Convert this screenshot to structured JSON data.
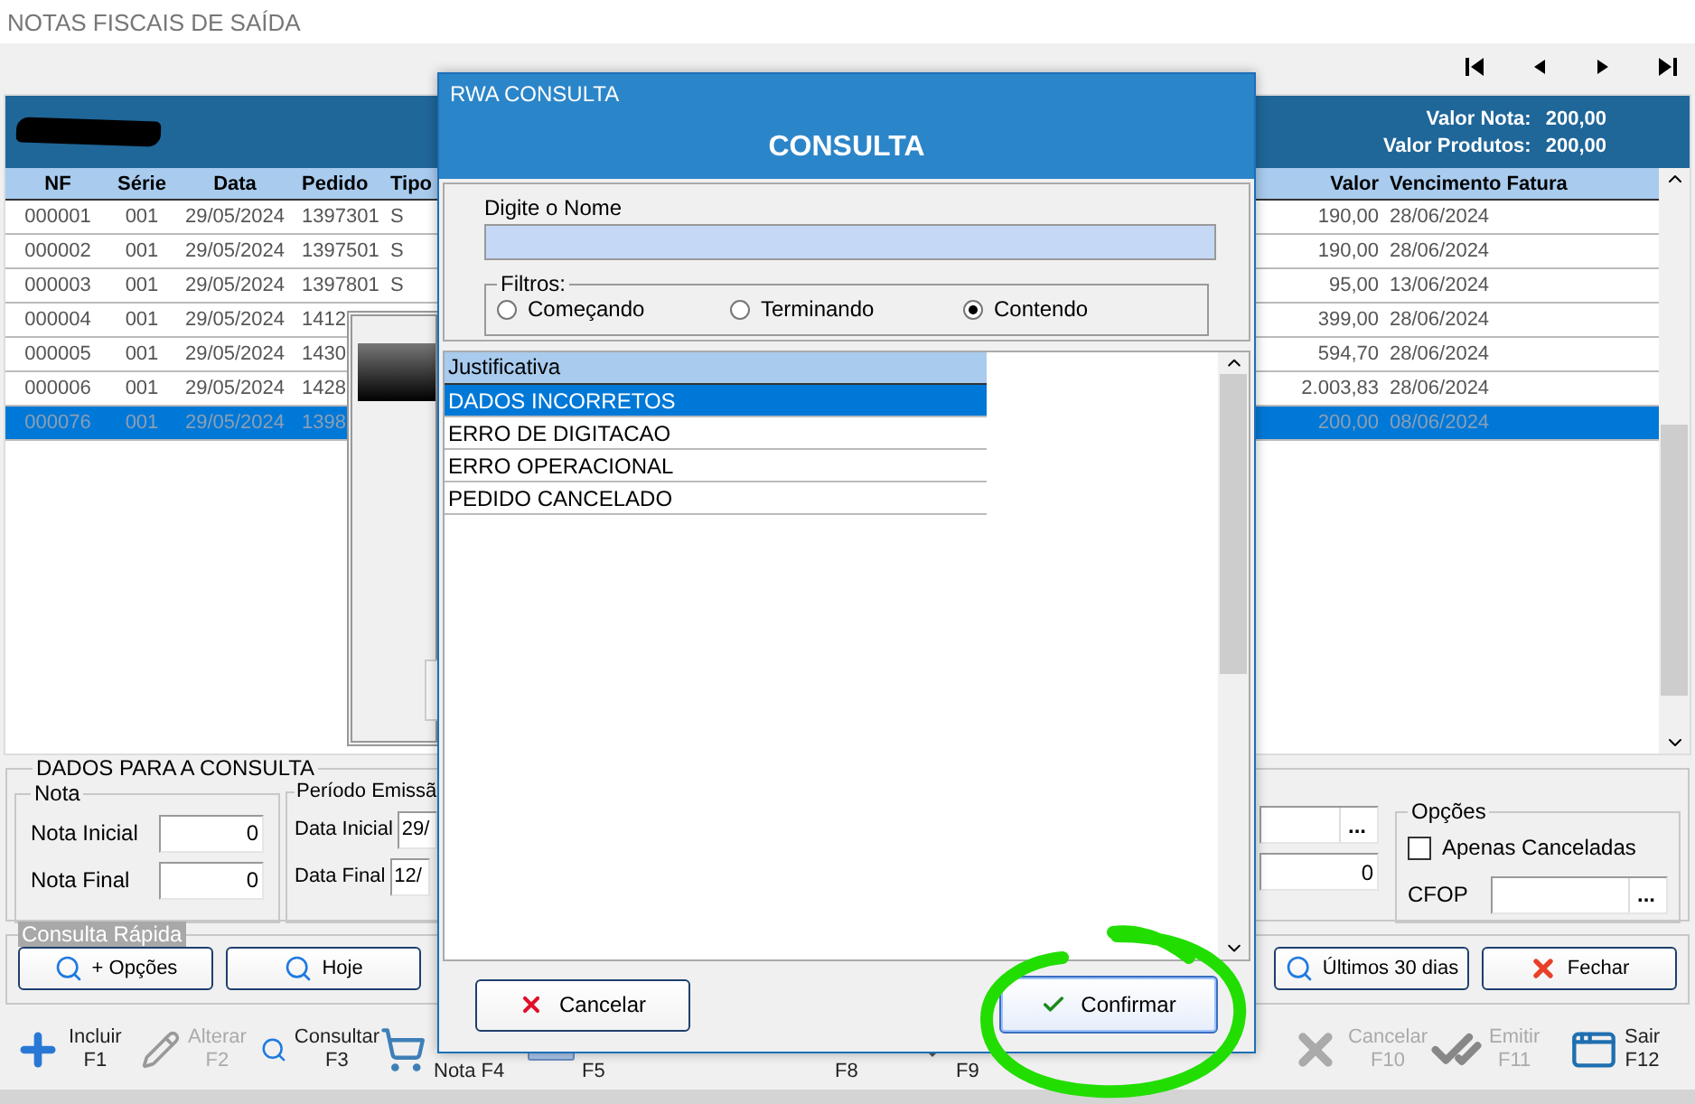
{
  "window": {
    "title": "NOTAS FISCAIS DE SAÍDA"
  },
  "navigator": [
    {
      "kind": "first"
    },
    {
      "kind": "previous"
    },
    {
      "kind": "next"
    },
    {
      "kind": "last"
    }
  ],
  "summary": [
    {
      "label": "Valor Nota:",
      "value": "200,00"
    },
    {
      "label": "Valor Produtos:",
      "value": "200,00"
    }
  ],
  "table": {
    "columns": [
      "NF",
      "Série",
      "Data",
      "Pedido",
      "Tipo",
      "Valor",
      "Vencimento Fatura"
    ],
    "rows": [
      {
        "nf": "000001",
        "serie": "001",
        "data": "29/05/2024",
        "pedido": "1397301",
        "tipo": "S",
        "valor": "190,00",
        "vencimento": "28/06/2024",
        "selected": false
      },
      {
        "nf": "000002",
        "serie": "001",
        "data": "29/05/2024",
        "pedido": "1397501",
        "tipo": "S",
        "valor": "190,00",
        "vencimento": "28/06/2024",
        "selected": false
      },
      {
        "nf": "000003",
        "serie": "001",
        "data": "29/05/2024",
        "pedido": "1397801",
        "tipo": "S",
        "valor": "95,00",
        "vencimento": "13/06/2024",
        "selected": false
      },
      {
        "nf": "000004",
        "serie": "001",
        "data": "29/05/2024",
        "pedido": "1412",
        "valor": "399,00",
        "vencimento": "28/06/2024",
        "selected": false
      },
      {
        "nf": "000005",
        "serie": "001",
        "data": "29/05/2024",
        "pedido": "1430",
        "valor": "594,70",
        "vencimento": "28/06/2024",
        "selected": false
      },
      {
        "nf": "000006",
        "serie": "001",
        "data": "29/05/2024",
        "pedido": "1428",
        "valor": "2.003,83",
        "vencimento": "28/06/2024",
        "selected": false
      },
      {
        "nf": "000076",
        "serie": "001",
        "data": "29/05/2024",
        "pedido": "1398",
        "valor": "200,00",
        "vencimento": "08/06/2024",
        "selected": true
      }
    ]
  },
  "query_panel": {
    "title": "DADOS PARA A CONSULTA",
    "nota": {
      "title": "Nota",
      "fields": [
        {
          "label": "Nota Inicial",
          "value": "0"
        },
        {
          "label": "Nota Final",
          "value": "0"
        }
      ]
    },
    "periodo": {
      "title": "Período Emissã",
      "fields": [
        {
          "label": "Data Inicial",
          "value": "29/"
        },
        {
          "label": "Data Final",
          "value": "12/"
        }
      ]
    },
    "partial_fields": [
      {
        "kind": "lookup",
        "button": "..."
      },
      {
        "kind": "number",
        "value": "0"
      }
    ],
    "options": {
      "title": "Opções",
      "checkbox": {
        "label": "Apenas Canceladas",
        "checked": false
      },
      "cfop": {
        "label": "CFOP",
        "button": "..."
      }
    }
  },
  "quick": {
    "title": "Consulta Rápida",
    "buttons": [
      {
        "label": "+ Opções",
        "kind": "search"
      },
      {
        "label": "Hoje",
        "kind": "search"
      },
      {
        "label": "Últimos 30 dias",
        "kind": "search"
      },
      {
        "label": "Fechar",
        "kind": "close"
      }
    ]
  },
  "toolbar": [
    {
      "kind": "add",
      "lines": [
        "Incluir",
        "F1"
      ],
      "disabled": false
    },
    {
      "kind": "edit",
      "lines": [
        "Alterar",
        "F2"
      ],
      "disabled": true
    },
    {
      "kind": "search",
      "lines": [
        "Consultar",
        "F3"
      ],
      "disabled": false
    },
    {
      "kind": "cart",
      "lines": [
        "Nota F4"
      ],
      "disabled": false
    },
    {
      "kind": "keyboard",
      "lines": [
        "F5"
      ],
      "disabled": false
    },
    {
      "kind": "plain",
      "lines": [
        "F8"
      ],
      "disabled": false
    },
    {
      "kind": "check",
      "lines": [
        "F9"
      ],
      "disabled": false
    },
    {
      "kind": "cancel",
      "lines": [
        "Cancelar",
        "F10"
      ],
      "disabled": true
    },
    {
      "kind": "emit",
      "lines": [
        "Emitir",
        "F11"
      ],
      "disabled": true
    },
    {
      "kind": "exit",
      "lines": [
        "Sair",
        "F12"
      ],
      "disabled": false
    }
  ],
  "dialog": {
    "app": "RWA CONSULTA",
    "title": "CONSULTA",
    "name_label": "Digite o Nome",
    "filters": {
      "title": "Filtros:",
      "options": [
        {
          "label": "Começando",
          "selected": false
        },
        {
          "label": "Terminando",
          "selected": false
        },
        {
          "label": "Contendo",
          "selected": true
        }
      ]
    },
    "list": {
      "column": "Justificativa",
      "rows": [
        {
          "label": "DADOS INCORRETOS",
          "selected": true
        },
        {
          "label": "ERRO DE DIGITACAO",
          "selected": false
        },
        {
          "label": "ERRO OPERACIONAL",
          "selected": false
        },
        {
          "label": "PEDIDO CANCELADO",
          "selected": false
        }
      ]
    },
    "buttons": [
      {
        "kind": "cancel",
        "label": "Cancelar"
      },
      {
        "kind": "confirm",
        "label": "Confirmar"
      }
    ]
  }
}
